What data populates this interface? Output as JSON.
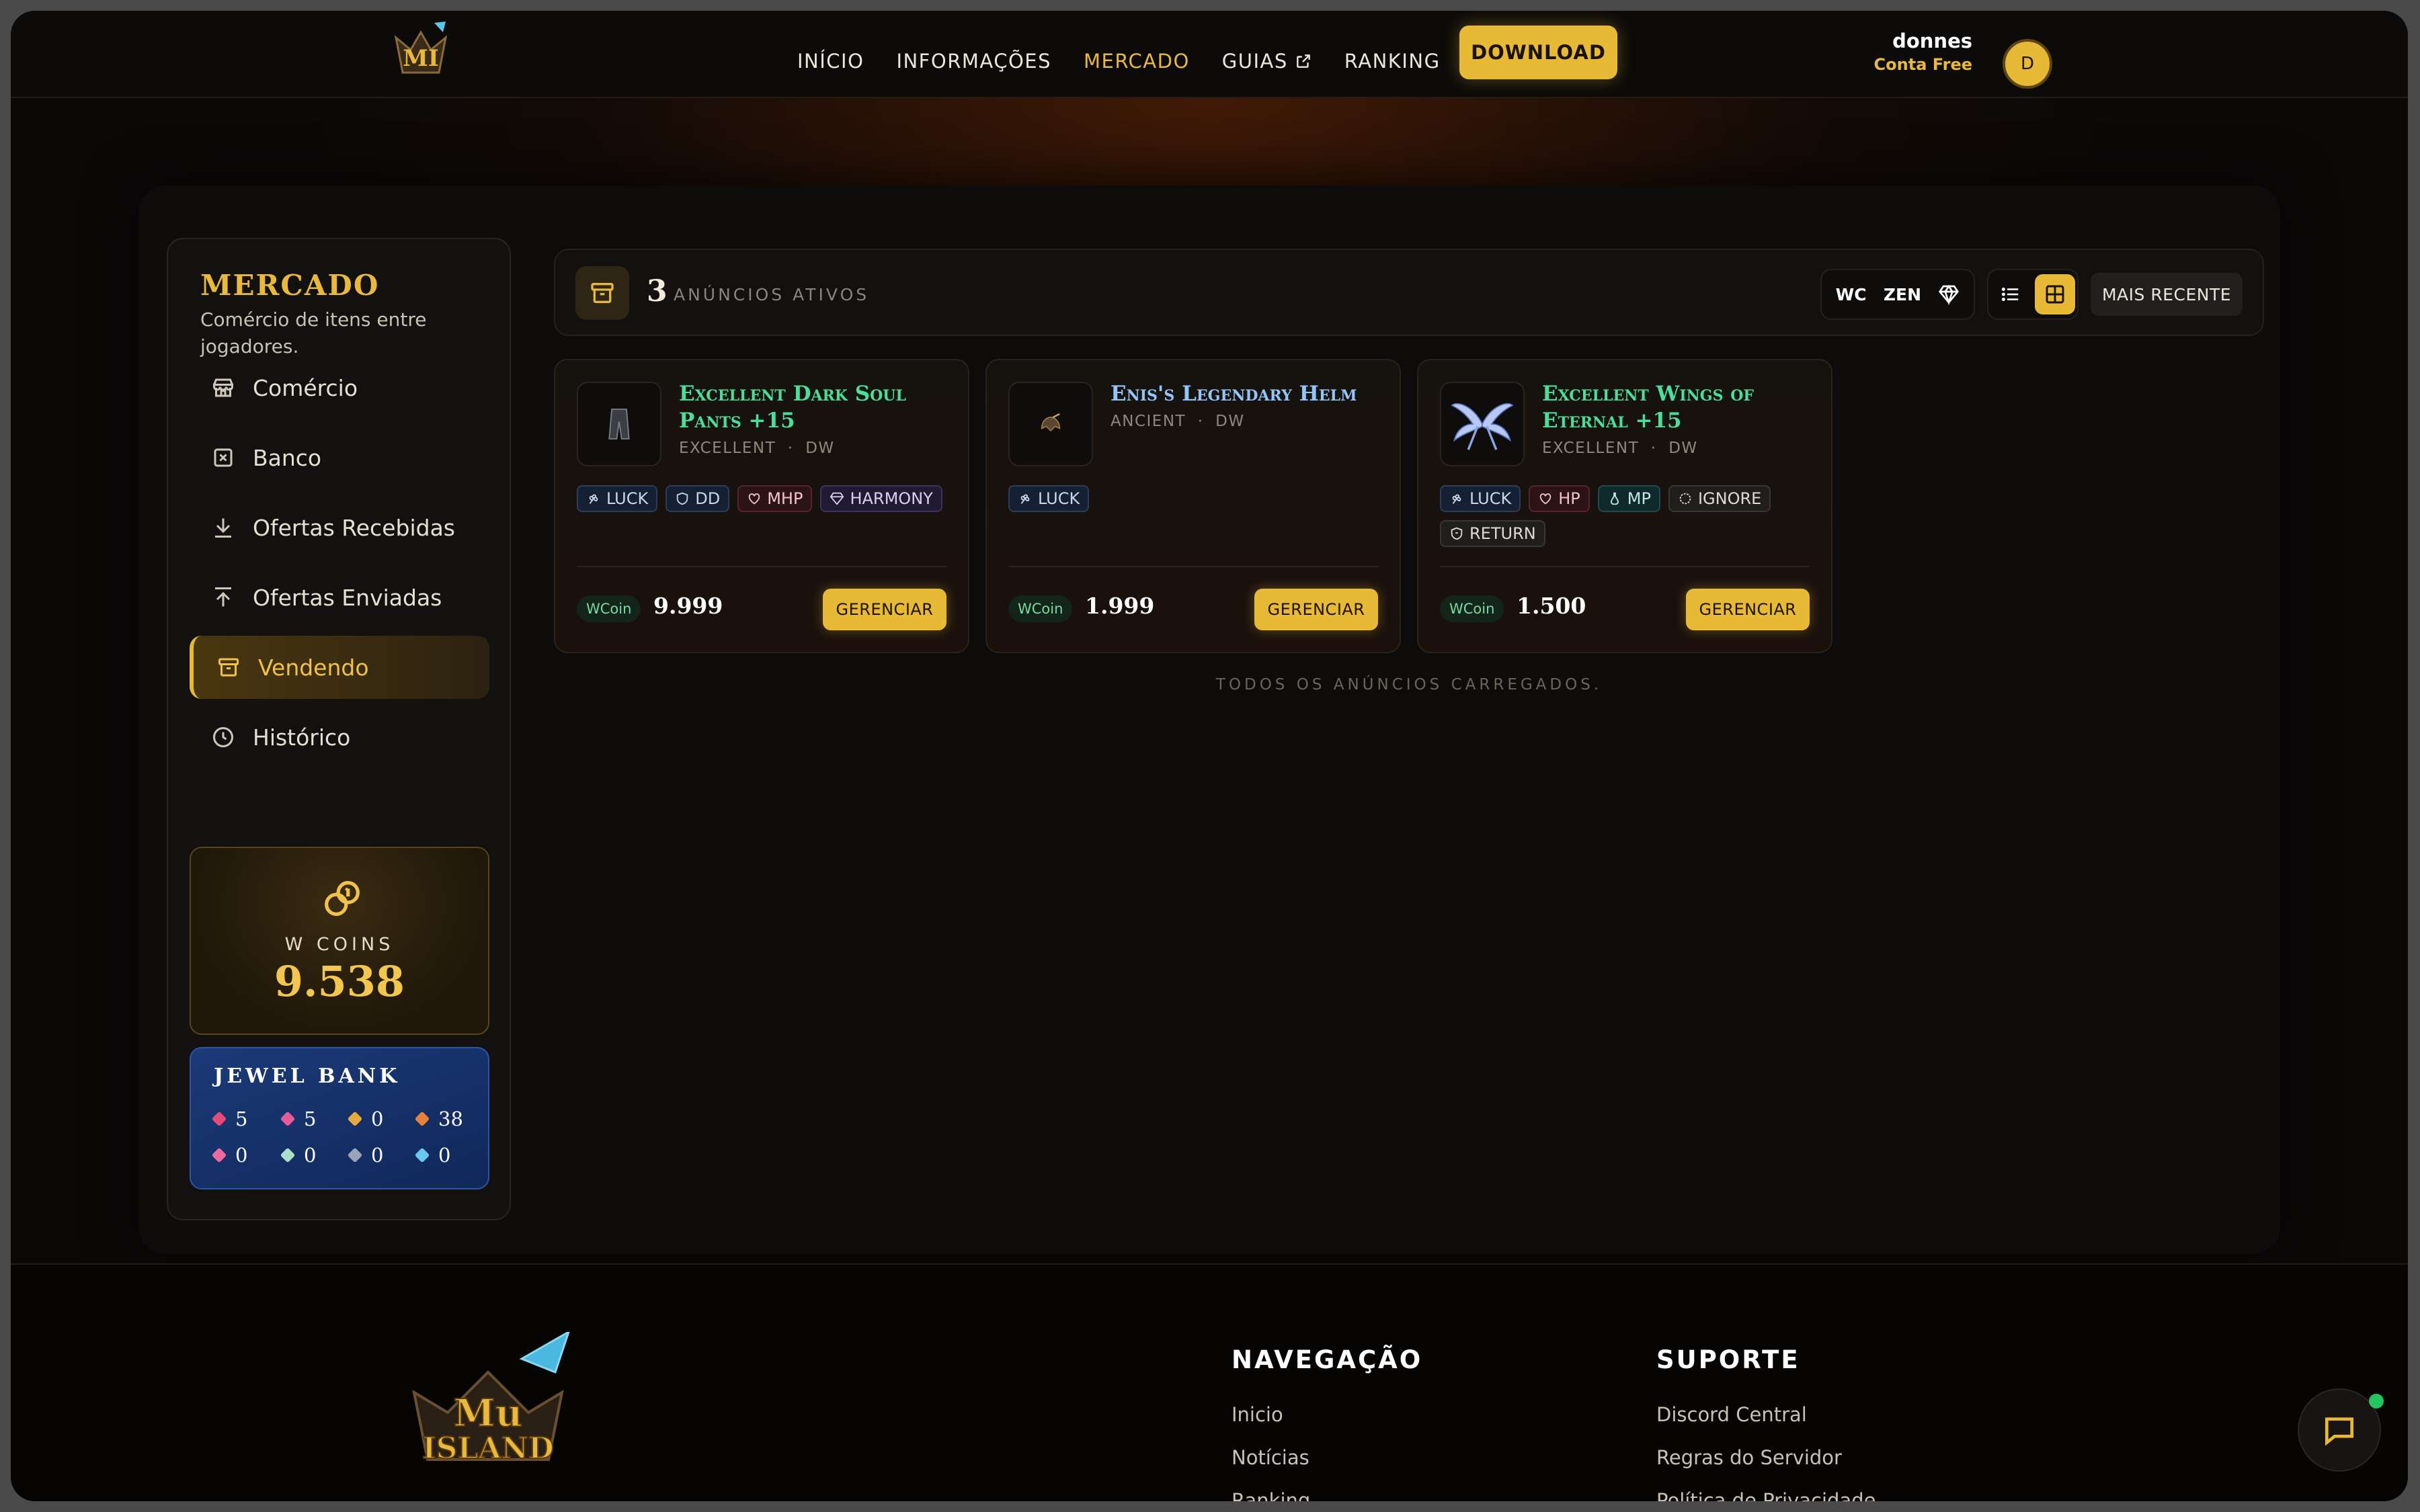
{
  "header": {
    "nav": [
      {
        "label": "INÍCIO"
      },
      {
        "label": "INFORMAÇÕES"
      },
      {
        "label": "MERCADO",
        "active": true
      },
      {
        "label": "GUIAS",
        "external": true
      },
      {
        "label": "RANKING"
      }
    ],
    "download_label": "DOWNLOAD",
    "user": {
      "name": "donnes",
      "plan": "Conta Free",
      "avatar_initial": "D"
    }
  },
  "sidebar": {
    "title": "MERCADO",
    "subtitle": "Comércio de itens entre jogadores.",
    "items": [
      {
        "label": "Comércio",
        "icon": "store-icon"
      },
      {
        "label": "Banco",
        "icon": "bank-icon"
      },
      {
        "label": "Ofertas Recebidas",
        "icon": "download-arrow-icon"
      },
      {
        "label": "Ofertas Enviadas",
        "icon": "upload-arrow-icon"
      },
      {
        "label": "Vendendo",
        "icon": "archive-box-icon",
        "active": true
      },
      {
        "label": "Histórico",
        "icon": "clock-icon"
      }
    ],
    "wcoins": {
      "label": "W COINS",
      "value": "9.538"
    },
    "jewel_bank": {
      "title": "JEWEL BANK",
      "jewels": [
        {
          "value": "5",
          "color": "#e84a7a"
        },
        {
          "value": "5",
          "color": "#e85a9a"
        },
        {
          "value": "0",
          "color": "#e8a93a"
        },
        {
          "value": "38",
          "color": "#e8823a"
        },
        {
          "value": "0",
          "color": "#f06aa0"
        },
        {
          "value": "0",
          "color": "#a8e0c8"
        },
        {
          "value": "0",
          "color": "#9aa4b8"
        },
        {
          "value": "0",
          "color": "#6ac8f0"
        }
      ]
    }
  },
  "toolbar": {
    "count": "3",
    "count_label": "ANÚNCIOS ATIVOS",
    "currency_wc": "WC",
    "currency_zen": "ZEN",
    "sort_label": "MAIS RECENTE"
  },
  "listings": [
    {
      "title": "Excellent Dark Soul Pants +15",
      "title_color": "#4ade9a",
      "type": "EXCELLENT",
      "class": "DW",
      "tags": [
        {
          "label": "LUCK",
          "style": "blue",
          "icon": "luck-icon"
        },
        {
          "label": "DD",
          "style": "blue",
          "icon": "shield-icon"
        },
        {
          "label": "MHP",
          "style": "red",
          "icon": "heart-icon"
        },
        {
          "label": "HARMONY",
          "style": "purple",
          "icon": "gem-icon"
        }
      ],
      "currency": "WCoin",
      "price": "9.999",
      "action": "GERENCIAR"
    },
    {
      "title": "Enis's Legendary Helm",
      "title_color": "#93c5fd",
      "type": "ANCIENT",
      "class": "DW",
      "tags": [
        {
          "label": "LUCK",
          "style": "blue",
          "icon": "luck-icon"
        }
      ],
      "currency": "WCoin",
      "price": "1.999",
      "action": "GERENCIAR"
    },
    {
      "title": "Excellent Wings of Eternal +15",
      "title_color": "#4ade9a",
      "type": "EXCELLENT",
      "class": "DW",
      "tags": [
        {
          "label": "LUCK",
          "style": "blue",
          "icon": "luck-icon"
        },
        {
          "label": "HP",
          "style": "red",
          "icon": "heart-icon"
        },
        {
          "label": "MP",
          "style": "teal",
          "icon": "potion-icon"
        },
        {
          "label": "IGNORE",
          "style": "grey",
          "icon": "target-icon"
        },
        {
          "label": "RETURN",
          "style": "grey",
          "icon": "shield-icon"
        }
      ],
      "currency": "WCoin",
      "price": "1.500",
      "action": "GERENCIAR"
    }
  ],
  "all_loaded": "TODOS OS ANÚNCIOS CARREGADOS.",
  "footer": {
    "nav_title": "NAVEGAÇÃO",
    "nav_links": [
      "Inicio",
      "Notícias",
      "Ranking"
    ],
    "support_title": "SUPORTE",
    "support_links": [
      "Discord Central",
      "Regras do Servidor",
      "Política de Privacidade"
    ]
  },
  "colors": {
    "accent": "#e8b935",
    "excellent": "#4ade9a",
    "ancient": "#93c5fd"
  }
}
